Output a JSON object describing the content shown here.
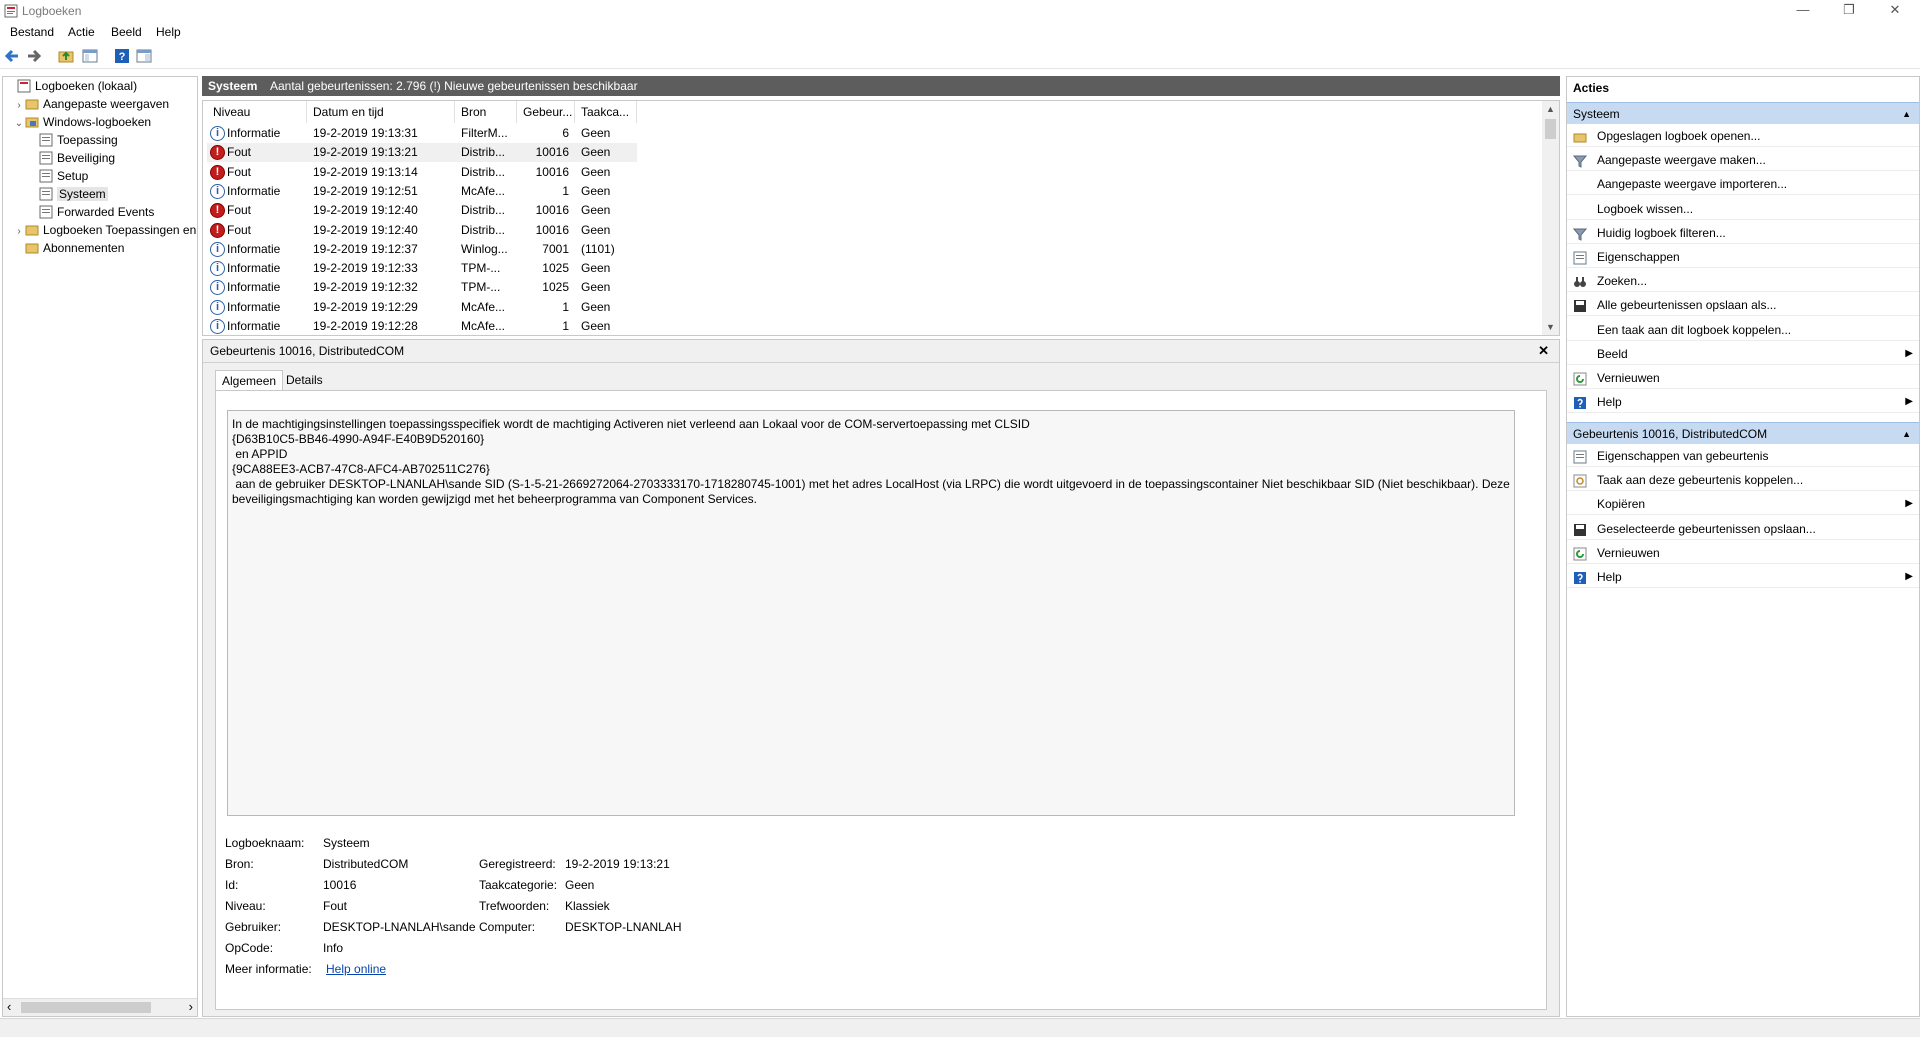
{
  "window": {
    "title": "Logboeken",
    "minimize": "—",
    "restore": "❐",
    "close": "✕"
  },
  "menu": [
    "Bestand",
    "Actie",
    "Beeld",
    "Help"
  ],
  "toolbar": {
    "icons": [
      "back-arrow-icon",
      "forward-arrow-icon",
      "folder-up-icon",
      "show-hide-console-tree-icon",
      "help-icon",
      "properties-icon"
    ],
    "help_glyph": "?"
  },
  "tree": {
    "root": "Logboeken (lokaal)",
    "custom_views": "Aangepaste weergaven",
    "windows_logs": "Windows-logboeken",
    "logs": [
      "Toepassing",
      "Beveiliging",
      "Setup",
      "Systeem",
      "Forwarded Events"
    ],
    "app_logs": "Logboeken Toepassingen en",
    "subscriptions": "Abonnementen",
    "selected": "Systeem",
    "scroll_left": "‹",
    "scroll_right": "›"
  },
  "center": {
    "log_name": "Systeem",
    "summary": "Aantal gebeurtenissen: 2.796 (!) Nieuwe gebeurtenissen beschikbaar"
  },
  "events": {
    "columns": [
      "Niveau",
      "Datum en tijd",
      "Bron",
      "Gebeur...",
      "Taakca..."
    ],
    "rows": [
      {
        "level": "Informatie",
        "type": "info",
        "datetime": "19-2-2019 19:13:31",
        "source": "FilterM...",
        "id": "6",
        "task": "Geen"
      },
      {
        "level": "Fout",
        "type": "error",
        "datetime": "19-2-2019 19:13:21",
        "source": "Distrib...",
        "id": "10016",
        "task": "Geen"
      },
      {
        "level": "Fout",
        "type": "error",
        "datetime": "19-2-2019 19:13:14",
        "source": "Distrib...",
        "id": "10016",
        "task": "Geen"
      },
      {
        "level": "Informatie",
        "type": "info",
        "datetime": "19-2-2019 19:12:51",
        "source": "McAfe...",
        "id": "1",
        "task": "Geen"
      },
      {
        "level": "Fout",
        "type": "error",
        "datetime": "19-2-2019 19:12:40",
        "source": "Distrib...",
        "id": "10016",
        "task": "Geen"
      },
      {
        "level": "Fout",
        "type": "error",
        "datetime": "19-2-2019 19:12:40",
        "source": "Distrib...",
        "id": "10016",
        "task": "Geen"
      },
      {
        "level": "Informatie",
        "type": "info",
        "datetime": "19-2-2019 19:12:37",
        "source": "Winlog...",
        "id": "7001",
        "task": "(1101)"
      },
      {
        "level": "Informatie",
        "type": "info",
        "datetime": "19-2-2019 19:12:33",
        "source": "TPM-...",
        "id": "1025",
        "task": "Geen"
      },
      {
        "level": "Informatie",
        "type": "info",
        "datetime": "19-2-2019 19:12:32",
        "source": "TPM-...",
        "id": "1025",
        "task": "Geen"
      },
      {
        "level": "Informatie",
        "type": "info",
        "datetime": "19-2-2019 19:12:29",
        "source": "McAfe...",
        "id": "1",
        "task": "Geen"
      },
      {
        "level": "Informatie",
        "type": "info",
        "datetime": "19-2-2019 19:12:28",
        "source": "McAfe...",
        "id": "1",
        "task": "Geen"
      }
    ],
    "selected_index": 1,
    "info_glyph": "i",
    "error_glyph": "!"
  },
  "detail": {
    "title": "Gebeurtenis 10016, DistributedCOM",
    "close_glyph": "✕",
    "tabs": [
      "Algemeen",
      "Details"
    ],
    "active_tab": "Algemeen",
    "message": "In de machtigingsinstellingen toepassingsspecifiek wordt de machtiging Activeren niet verleend aan Lokaal voor de COM-servertoepassing met CLSID\n{D63B10C5-BB46-4990-A94F-E40B9D520160}\n en APPID\n{9CA88EE3-ACB7-47C8-AFC4-AB702511C276}\n aan de gebruiker DESKTOP-LNANLAH\\sande SID (S-1-5-21-2669272064-2703333170-1718280745-1001) met het adres LocalHost (via LRPC) die wordt uitgevoerd in de toepassingscontainer Niet beschikbaar SID (Niet beschikbaar). Deze\nbeveiligingsmachtiging kan worden gewijzigd met het beheerprogramma van Component Services.",
    "props": {
      "logname_label": "Logboeknaam:",
      "logname": "Systeem",
      "source_label": "Bron:",
      "source": "DistributedCOM",
      "id_label": "Id:",
      "id": "10016",
      "level_label": "Niveau:",
      "level": "Fout",
      "user_label": "Gebruiker:",
      "user": "DESKTOP-LNANLAH\\sande",
      "opcode_label": "OpCode:",
      "opcode": "Info",
      "more_label": "Meer informatie:",
      "more_link": "Help online",
      "registered_label": "Geregistreerd:",
      "registered": "19-2-2019 19:13:21",
      "taskcat_label": "Taakcategorie:",
      "taskcat": "Geen",
      "keywords_label": "Trefwoorden:",
      "keywords": "Klassiek",
      "computer_label": "Computer:",
      "computer": "DESKTOP-LNANLAH"
    }
  },
  "actions": {
    "title": "Acties",
    "section1": "Systeem",
    "items1": [
      {
        "label": "Opgeslagen logboek openen...",
        "icon": "open-folder-icon"
      },
      {
        "label": "Aangepaste weergave maken...",
        "icon": "filter-create-icon"
      },
      {
        "label": "Aangepaste weergave importeren...",
        "icon": ""
      },
      {
        "label": "Logboek wissen...",
        "icon": ""
      },
      {
        "label": "Huidig logboek filteren...",
        "icon": "filter-icon"
      },
      {
        "label": "Eigenschappen",
        "icon": "properties-icon"
      },
      {
        "label": "Zoeken...",
        "icon": "binoculars-icon"
      },
      {
        "label": "Alle gebeurtenissen opslaan als...",
        "icon": "save-icon"
      },
      {
        "label": "Een taak aan dit logboek koppelen...",
        "icon": ""
      },
      {
        "label": "Beeld",
        "icon": "",
        "submenu": true
      },
      {
        "label": "Vernieuwen",
        "icon": "refresh-icon"
      },
      {
        "label": "Help",
        "icon": "help-icon",
        "submenu": true
      }
    ],
    "section2": "Gebeurtenis 10016, DistributedCOM",
    "items2": [
      {
        "label": "Eigenschappen van gebeurtenis",
        "icon": "properties-icon"
      },
      {
        "label": "Taak aan deze gebeurtenis koppelen...",
        "icon": "task-icon"
      },
      {
        "label": "Kopiëren",
        "icon": "",
        "submenu": true
      },
      {
        "label": "Geselecteerde gebeurtenissen opslaan...",
        "icon": "save-icon"
      },
      {
        "label": "Vernieuwen",
        "icon": "refresh-icon"
      },
      {
        "label": "Help",
        "icon": "help-icon",
        "submenu": true
      }
    ],
    "collapse_glyph": "▲",
    "submenu_glyph": "▶"
  }
}
